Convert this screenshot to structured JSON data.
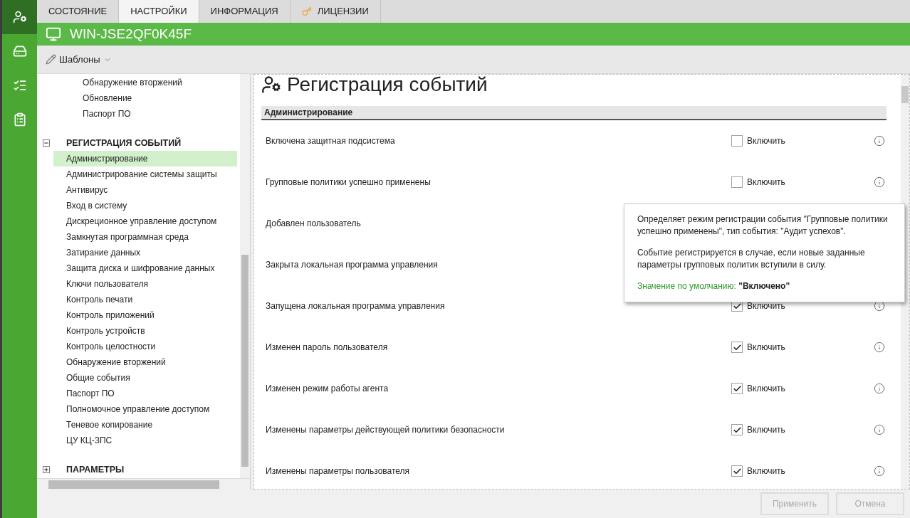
{
  "rail": [
    {
      "kind": "agent",
      "selected": true
    },
    {
      "kind": "policy",
      "selected": false
    },
    {
      "kind": "journal",
      "selected": false
    },
    {
      "kind": "report",
      "selected": false
    }
  ],
  "tabs": [
    {
      "label": "СОСТОЯНИЕ",
      "selected": false
    },
    {
      "label": "НАСТРОЙКИ",
      "selected": true
    },
    {
      "label": "ИНФОРМАЦИЯ",
      "selected": false
    },
    {
      "label": "ЛИЦЕНЗИИ",
      "selected": false,
      "kind": "license"
    }
  ],
  "computer": {
    "name": "WIN-JSE2QF0K45F"
  },
  "toolbar": {
    "templates": "Шаблоны"
  },
  "tree": {
    "leading_items": [
      {
        "label": "Обнаружение вторжений",
        "selected": false
      },
      {
        "label": "Обновление",
        "selected": false
      },
      {
        "label": "Паспорт ПО",
        "selected": false
      }
    ],
    "groups": [
      {
        "label": "РЕГИСТРАЦИЯ СОБЫТИЙ",
        "expanded": true,
        "children": [
          {
            "label": "Администрирование",
            "selected": true
          },
          {
            "label": "Администрирование системы защиты",
            "selected": false
          },
          {
            "label": "Антивирус",
            "selected": false
          },
          {
            "label": "Вход в систему",
            "selected": false
          },
          {
            "label": "Дискреционное управление доступом",
            "selected": false
          },
          {
            "label": "Замкнутая программная среда",
            "selected": false
          },
          {
            "label": "Затирание данных",
            "selected": false
          },
          {
            "label": "Защита диска и шифрование данных",
            "selected": false
          },
          {
            "label": "Ключи пользователя",
            "selected": false
          },
          {
            "label": "Контроль печати",
            "selected": false
          },
          {
            "label": "Контроль приложений",
            "selected": false
          },
          {
            "label": "Контроль устройств",
            "selected": false
          },
          {
            "label": "Контроль целостности",
            "selected": false
          },
          {
            "label": "Обнаружение вторжений",
            "selected": false
          },
          {
            "label": "Общие события",
            "selected": false
          },
          {
            "label": "Паспорт ПО",
            "selected": false
          },
          {
            "label": "Полномочное управление доступом",
            "selected": false
          },
          {
            "label": "Теневое копирование",
            "selected": false
          },
          {
            "label": "ЦУ КЦ-ЗПС",
            "selected": false
          }
        ]
      },
      {
        "label": "ПАРАМЕТРЫ",
        "expanded": false
      }
    ]
  },
  "page": {
    "title": "Регистрация событий",
    "section": "Администрирование",
    "rows": [
      {
        "label": "Включена защитная подсистема",
        "kind": "toggle",
        "checked": false,
        "toggle_label": "Включить"
      },
      {
        "label": "Групповые политики успешно применены",
        "kind": "toggle",
        "checked": false,
        "toggle_label": "Включить"
      },
      {
        "label": "Добавлен пользователь",
        "kind": "covered"
      },
      {
        "label": "Закрыта локальная программа управления",
        "kind": "covered"
      },
      {
        "label": "Запущена локальная программа управления",
        "kind": "toggle",
        "checked": true,
        "toggle_label": "Включить"
      },
      {
        "label": "Изменен пароль пользователя",
        "kind": "toggle",
        "checked": true,
        "toggle_label": "Включить"
      },
      {
        "label": "Изменен режим работы агента",
        "kind": "toggle",
        "checked": true,
        "toggle_label": "Включить"
      },
      {
        "label": "Изменены параметры действующей политики безопасности",
        "kind": "toggle",
        "checked": true,
        "toggle_label": "Включить"
      },
      {
        "label": "Изменены параметры пользователя",
        "kind": "toggle",
        "checked": true,
        "toggle_label": "Включить"
      }
    ]
  },
  "tooltip": {
    "paragraphs": [
      "Определяет режим регистрации события \"Групповые политики успешно применены\", тип события: \"Аудит успехов\".",
      "Событие регистрируется в случае, если новые заданные параметры групповых политик вступили в силу."
    ],
    "default_label": "Значение по умолчанию:",
    "default_value": "\"Включено\""
  },
  "footer": [
    {
      "label": "Применить",
      "disabled": true
    },
    {
      "label": "Отмена",
      "disabled": true
    }
  ]
}
